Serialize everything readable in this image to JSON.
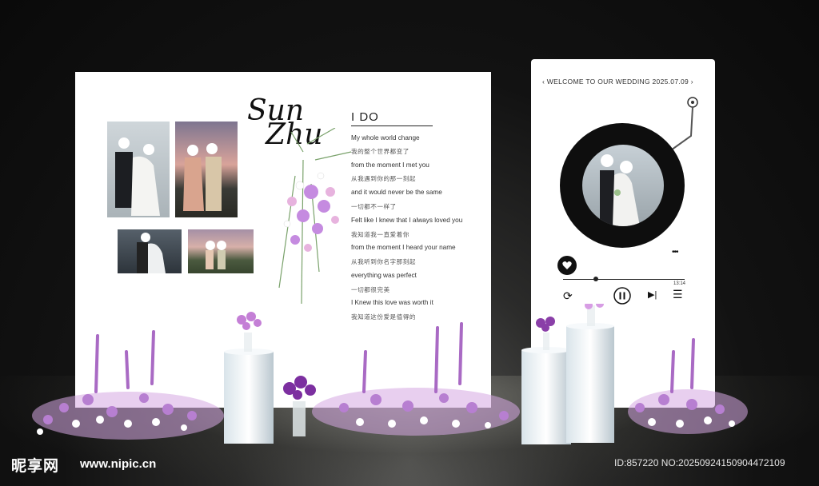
{
  "couple_signature": {
    "line1": "Sun",
    "line2": "Zhu"
  },
  "lyrics_card": {
    "title": "I DO",
    "lines": [
      "My whole world change",
      "我的整个世界都变了",
      "from the moment I met you",
      "从我遇到你的那一刻起",
      "and it would never be the same",
      "一切都不一样了",
      "Felt like I knew that I always loved you",
      "我知道我一直爱着你",
      "from the moment I heard your name",
      "从我听到你名字那刻起",
      "everything was perfect",
      "一切都很完美",
      "I Knew this love was worth it",
      "我知道这份爱是值得的"
    ]
  },
  "player": {
    "back_icon": "chevron-left-icon",
    "header": "WELCOME TO OUR WEDDING  2025.07.09",
    "more_icon": "more-dots-icon",
    "like_icon": "heart-icon",
    "time_end": "13:14",
    "progress": 0.27,
    "controls": [
      "repeat-icon",
      "pause-icon",
      "next-icon",
      "playlist-icon"
    ]
  },
  "watermark": {
    "logo": "昵享网",
    "url": "www.nipic.cn",
    "id": "ID:857220 NO:20250924150904472109"
  },
  "colors": {
    "background": "#0a0a0a",
    "board": "#ffffff",
    "flower_purple": "#b77fd1",
    "flower_pink": "#e7a7d6",
    "vinyl": "#0e0e0e"
  }
}
